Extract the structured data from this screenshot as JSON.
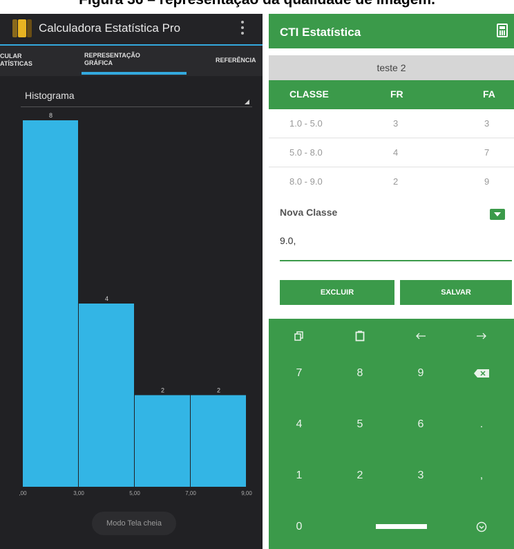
{
  "figure_caption": "Figura 36 – representação da qualidade de imagem.",
  "left_app": {
    "title": "Calculadora Estatística Pro",
    "tabs": [
      "CULAR\nATÍSTICAS",
      "REPRESENTAÇÃO\nGRÁFICA",
      "REFERÊNCIA"
    ],
    "chart_selector": "Histograma",
    "fullscreen_button": "Modo Tela cheia",
    "colors": {
      "bar": "#33b5e5",
      "accent": "#33a9de",
      "background": "#212124"
    }
  },
  "chart_data": {
    "type": "bar",
    "categories": [
      "1,00 - 3,00",
      "3,00 - 5,00",
      "5,00 - 7,00",
      "7,00 - 9,00"
    ],
    "values": [
      8,
      4,
      2,
      2
    ],
    "x_tick_labels": [
      ",00",
      "3,00",
      "5,00",
      "7,00",
      "9,00"
    ],
    "ylim": [
      0,
      8
    ],
    "title": "",
    "xlabel": "",
    "ylabel": "",
    "grid": false,
    "legend": "none"
  },
  "right_app": {
    "title": "CTI Estatística",
    "title_icon": "calculator-icon",
    "dataset_name": "teste 2",
    "table": {
      "headers": [
        "CLASSE",
        "FR",
        "FA"
      ],
      "rows": [
        [
          "1.0 - 5.0",
          "3",
          "3"
        ],
        [
          "5.0 - 8.0",
          "4",
          "7"
        ],
        [
          "8.0 - 9.0",
          "2",
          "9"
        ]
      ]
    },
    "new_class_label": "Nova Classe",
    "new_class_value": "9.0,",
    "delete_button": "EXCLUIR",
    "save_button": "SALVAR",
    "keypad": {
      "row1_icons": [
        "copy-icon",
        "paste-icon",
        "arrow-left-icon",
        "arrow-right-icon"
      ],
      "row2": [
        "7",
        "8",
        "9"
      ],
      "row3": [
        "4",
        "5",
        "6",
        "."
      ],
      "row4": [
        "1",
        "2",
        "3",
        ","
      ],
      "row5": [
        "0"
      ],
      "backspace_icon": "backspace-icon",
      "done_icon": "check-circle-icon",
      "space_icon": "space-bar-icon"
    },
    "colors": {
      "primary": "#3b9a4a",
      "header_gray": "#d6d6d6"
    }
  }
}
